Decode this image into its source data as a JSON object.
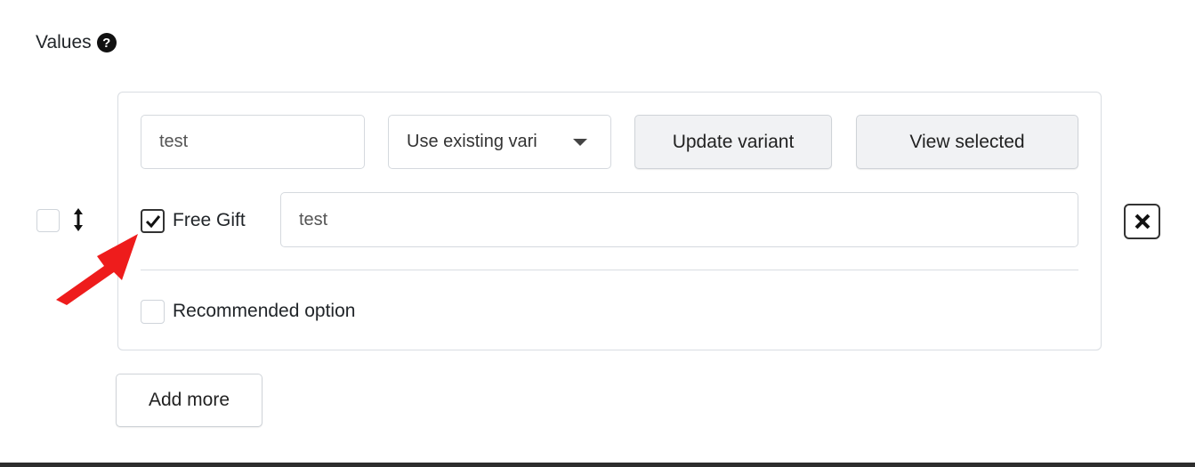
{
  "section": {
    "title": "Values",
    "help_icon": "question-circle-icon"
  },
  "value_row": {
    "value_text": "test",
    "variant_select": "Use existing vari",
    "update_button": "Update variant",
    "view_button": "View selected",
    "free_gift": {
      "label": "Free Gift",
      "checked": true,
      "text_value": "test"
    },
    "recommended": {
      "label": "Recommended option",
      "checked": false
    },
    "remove_icon": "close-icon"
  },
  "add_more_label": "Add more",
  "annotation": {
    "type": "red-arrow",
    "color": "#ee1c1c"
  }
}
